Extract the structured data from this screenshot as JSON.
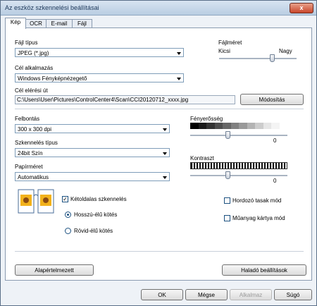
{
  "window": {
    "title": "Az eszköz szkennelési beállításai",
    "close_label": "x"
  },
  "tabs": [
    {
      "label": "Kép"
    },
    {
      "label": "OCR"
    },
    {
      "label": "E-mail"
    },
    {
      "label": "Fájl"
    }
  ],
  "image_tab": {
    "file_type": {
      "label": "Fájl típus",
      "value": "JPEG (*.jpg)"
    },
    "file_size": {
      "label": "Fájlméret",
      "min_label": "Kicsi",
      "max_label": "Nagy",
      "level": 0.68
    },
    "target_app": {
      "label": "Cél alkalmazás",
      "value": "Windows Fényképnézegető"
    },
    "target_path": {
      "label": "Cél elérési út",
      "value": "C:\\Users\\User\\Pictures\\ControlCenter4\\Scan\\CCI20120712_xxxx.jpg",
      "modify_button": "Módosítás"
    },
    "resolution": {
      "label": "Felbontás",
      "value": "300 x 300 dpi"
    },
    "scan_type": {
      "label": "Szkennelés típus",
      "value": "24bit Szín"
    },
    "paper_size": {
      "label": "Papírméret",
      "value": "Automatikus"
    },
    "brightness": {
      "label": "Fényerősség",
      "value": "0"
    },
    "contrast": {
      "label": "Kontraszt",
      "value": "0"
    },
    "duplex": {
      "label": "Kétoldalas szkennelés",
      "checked": true,
      "long_edge": "Hosszú-élű kötés",
      "short_edge": "Rövid-élű kötés",
      "selected": "long"
    },
    "carrier_sheet": {
      "label": "Hordozó tasak mód",
      "checked": false
    },
    "plastic_card": {
      "label": "Műanyag kártya mód",
      "checked": false
    },
    "default_button": "Alapértelmezett",
    "advanced_button": "Haladó beállítások"
  },
  "footer": {
    "ok": "OK",
    "cancel": "Mégse",
    "apply": "Alkalmaz",
    "help": "Súgó"
  }
}
